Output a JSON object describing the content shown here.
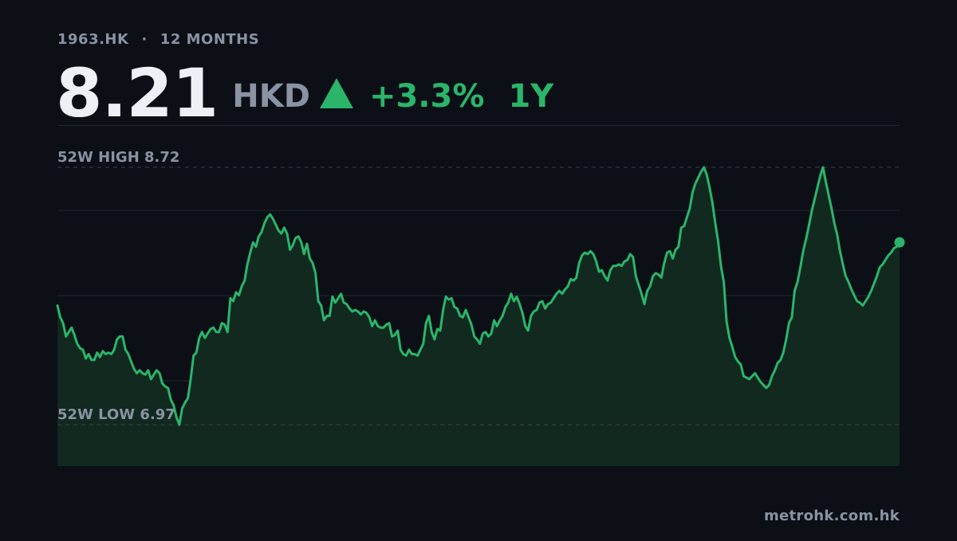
{
  "header": {
    "ticker": "1963.HK",
    "separator": "·",
    "range_label": "12 MONTHS"
  },
  "price": {
    "value": "8.21",
    "currency": "HKD",
    "change": "+3.3%",
    "period": "1Y",
    "direction_icon": "triangle-up-icon"
  },
  "colors": {
    "background": "#0c0f16",
    "accent_up": "#2ab56a",
    "line": "#2ab56a",
    "area_fill": "#11291f",
    "muted_text": "#8a93a3",
    "gridline": "#222733"
  },
  "footer": {
    "source": "metrohk.com.hk"
  },
  "chart_data": {
    "type": "area",
    "x_unit": "trading day index (12-month window)",
    "y_unit": "HKD",
    "ylim": [
      6.62,
      8.75
    ],
    "grid": true,
    "reference_lines": [
      {
        "label": "52W HIGH",
        "value": "8.72",
        "y": 8.72
      },
      {
        "label": "52W LOW",
        "value": "6.97",
        "y": 6.97
      }
    ],
    "series": [
      {
        "values": [
          7.78,
          7.7,
          7.66,
          7.57,
          7.6,
          7.63,
          7.58,
          7.52,
          7.49,
          7.48,
          7.42,
          7.45,
          7.41,
          7.41,
          7.46,
          7.43,
          7.47,
          7.45,
          7.46,
          7.45,
          7.48,
          7.55,
          7.57,
          7.57,
          7.48,
          7.45,
          7.4,
          7.35,
          7.32,
          7.34,
          7.32,
          7.31,
          7.34,
          7.28,
          7.31,
          7.34,
          7.32,
          7.25,
          7.23,
          7.22,
          7.14,
          7.1,
          7.02,
          6.97,
          7.08,
          7.12,
          7.15,
          7.28,
          7.44,
          7.46,
          7.56,
          7.6,
          7.56,
          7.59,
          7.62,
          7.63,
          7.6,
          7.6,
          7.66,
          7.65,
          7.6,
          7.83,
          7.81,
          7.87,
          7.85,
          7.91,
          7.95,
          8.06,
          8.14,
          8.21,
          8.18,
          8.25,
          8.28,
          8.34,
          8.38,
          8.4,
          8.37,
          8.33,
          8.29,
          8.27,
          8.31,
          8.27,
          8.16,
          8.19,
          8.24,
          8.25,
          8.21,
          8.13,
          8.2,
          8.1,
          8.07,
          8.0,
          7.81,
          7.78,
          7.68,
          7.71,
          7.71,
          7.84,
          7.8,
          7.83,
          7.86,
          7.8,
          7.79,
          7.76,
          7.74,
          7.75,
          7.74,
          7.72,
          7.74,
          7.73,
          7.7,
          7.64,
          7.68,
          7.64,
          7.63,
          7.63,
          7.65,
          7.66,
          7.57,
          7.58,
          7.61,
          7.48,
          7.45,
          7.44,
          7.48,
          7.45,
          7.45,
          7.44,
          7.48,
          7.52,
          7.66,
          7.71,
          7.6,
          7.55,
          7.62,
          7.61,
          7.75,
          7.84,
          7.82,
          7.83,
          7.77,
          7.76,
          7.71,
          7.7,
          7.75,
          7.7,
          7.65,
          7.57,
          7.55,
          7.52,
          7.59,
          7.6,
          7.57,
          7.59,
          7.68,
          7.64,
          7.68,
          7.71,
          7.77,
          7.8,
          7.86,
          7.81,
          7.84,
          7.79,
          7.73,
          7.64,
          7.61,
          7.71,
          7.74,
          7.75,
          7.8,
          7.81,
          7.76,
          7.79,
          7.8,
          7.83,
          7.86,
          7.88,
          7.86,
          7.89,
          7.91,
          7.96,
          7.95,
          7.97,
          8.07,
          8.12,
          8.14,
          8.13,
          8.15,
          8.13,
          8.08,
          8.01,
          8.02,
          7.98,
          7.95,
          8.02,
          8.05,
          8.05,
          8.06,
          8.05,
          8.08,
          8.09,
          8.13,
          8.11,
          7.98,
          7.92,
          7.86,
          7.79,
          7.88,
          7.91,
          7.98,
          8.0,
          7.99,
          7.97,
          8.07,
          8.14,
          8.15,
          8.1,
          8.16,
          8.18,
          8.31,
          8.32,
          8.38,
          8.44,
          8.55,
          8.61,
          8.65,
          8.69,
          8.72,
          8.67,
          8.58,
          8.48,
          8.34,
          8.22,
          8.05,
          7.94,
          7.67,
          7.56,
          7.5,
          7.43,
          7.4,
          7.38,
          7.3,
          7.29,
          7.28,
          7.3,
          7.32,
          7.29,
          7.26,
          7.24,
          7.22,
          7.24,
          7.3,
          7.34,
          7.39,
          7.41,
          7.46,
          7.55,
          7.66,
          7.7,
          7.88,
          7.94,
          8.04,
          8.15,
          8.23,
          8.32,
          8.42,
          8.5,
          8.58,
          8.66,
          8.72,
          8.62,
          8.53,
          8.44,
          8.34,
          8.26,
          8.15,
          8.06,
          7.98,
          7.94,
          7.89,
          7.85,
          7.81,
          7.8,
          7.78,
          7.81,
          7.84,
          7.88,
          7.93,
          7.98,
          8.04,
          8.06,
          8.09,
          8.12,
          8.14,
          8.17,
          8.18,
          8.21
        ]
      }
    ]
  }
}
